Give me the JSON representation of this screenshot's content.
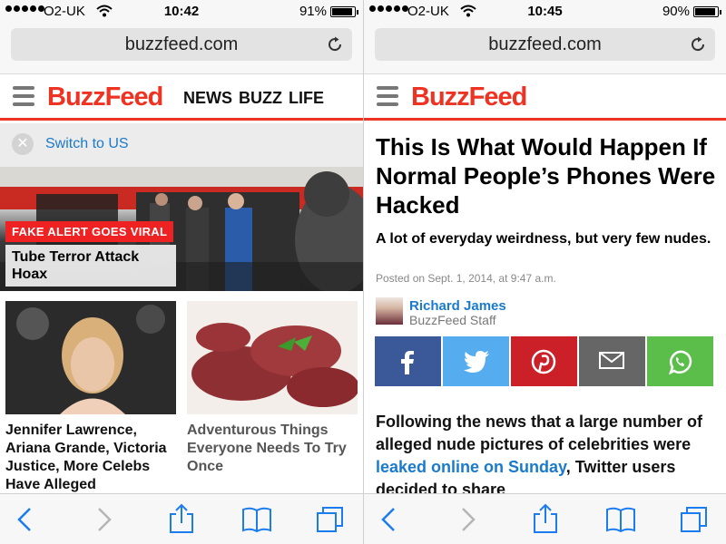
{
  "left": {
    "status": {
      "carrier": "O2-UK",
      "time": "10:42",
      "battery": "91%",
      "battery_level": 0.91
    },
    "url": "buzzfeed.com",
    "logo": "BuzzFeed",
    "nav": [
      "NEWS",
      "BUZZ",
      "LIFE"
    ],
    "switch_text": "Switch to US",
    "hero": {
      "tag": "FAKE ALERT GOES VIRAL",
      "title": "Tube Terror Attack Hoax"
    },
    "cards": [
      {
        "title": "Jennifer Lawrence, Ariana Grande, Victoria Justice, More Celebs Have Alleged"
      },
      {
        "title": "Adventurous Things Everyone Needs To Try Once"
      }
    ]
  },
  "right": {
    "status": {
      "carrier": "O2-UK",
      "time": "10:45",
      "battery": "90%",
      "battery_level": 0.9
    },
    "url": "buzzfeed.com",
    "logo": "BuzzFeed",
    "article": {
      "title": "This Is What Would Happen If Normal People’s Phones Were Hacked",
      "subtitle": "A lot of everyday weirdness, but very few nudes.",
      "date": "Posted on Sept. 1, 2014, at 9:47 a.m.",
      "author": "Richard James",
      "author_role": "BuzzFeed Staff",
      "body_start": "Following the news that a large number of alleged nude pictures of celebrities were ",
      "body_link": "leaked online on Sunday",
      "body_end": ", Twitter users decided to share"
    },
    "share": [
      {
        "name": "facebook",
        "icon": "facebook-icon",
        "color": "#3b5998"
      },
      {
        "name": "twitter",
        "icon": "twitter-icon",
        "color": "#55acee"
      },
      {
        "name": "pinterest",
        "icon": "pinterest-icon",
        "color": "#cb2027"
      },
      {
        "name": "email",
        "icon": "mail-icon",
        "color": "#666666"
      },
      {
        "name": "whatsapp",
        "icon": "whatsapp-icon",
        "color": "#5cbe4a"
      }
    ]
  },
  "colors": {
    "brand_red": "#ee3322",
    "link_blue": "#1a7acc",
    "ios_blue": "#1b7cf0"
  }
}
